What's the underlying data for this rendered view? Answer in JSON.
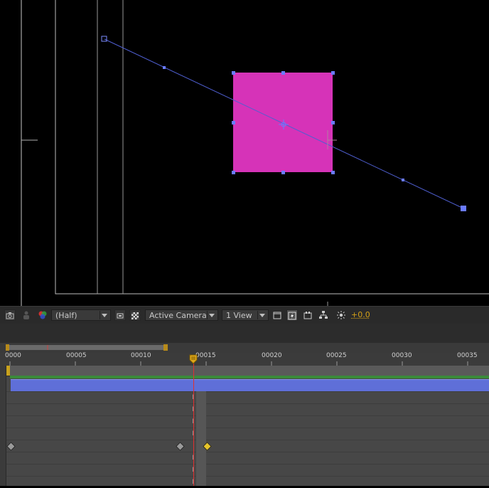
{
  "toolbar": {
    "resolution": "(Half)",
    "camera": "Active Camera",
    "views": "1 View",
    "exposure": "+0.0",
    "icons": [
      "snapshot-icon",
      "show-snapshot-icon",
      "color-channels-icon",
      "region-of-interest-icon",
      "transparency-grid-icon",
      "comp-flowchart-icon",
      "fast-previews-icon",
      "timeline-icon",
      "flowchart-icon",
      "reset-exposure-icon"
    ]
  },
  "ruler": {
    "labels": [
      "0000",
      "00005",
      "00010",
      "00015",
      "00020",
      "00025",
      "00030",
      "00035"
    ],
    "current_frame": 14
  },
  "colors": {
    "layer_solid": "#d633b8",
    "motion_path": "#4f5fd1",
    "layer_bar": "#5f6fd8",
    "playhead": "#e03030",
    "selected_keyframe": "#e6c42a",
    "exposure": "#d4a017"
  }
}
